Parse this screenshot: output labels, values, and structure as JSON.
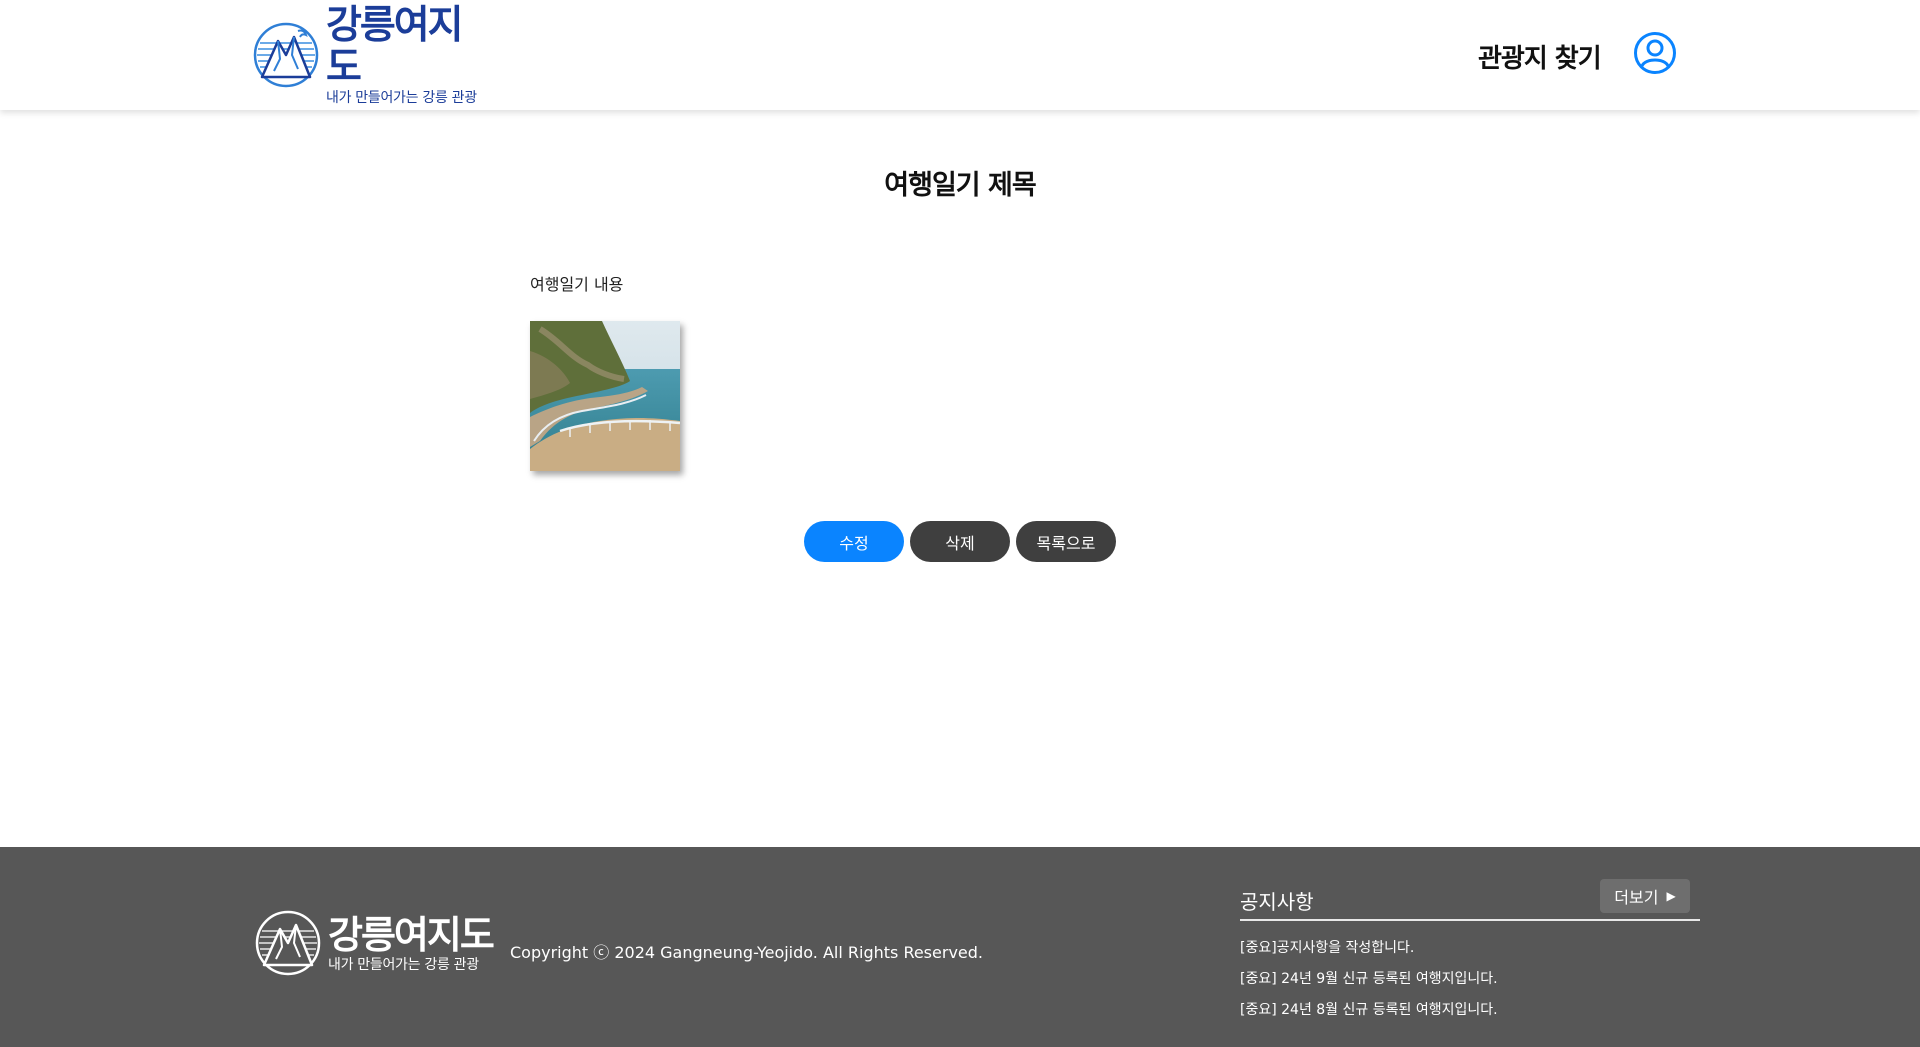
{
  "header": {
    "logo_title": "강릉여지도",
    "logo_subtitle": "내가 만들어가는 강릉 관광",
    "nav_find": "관광지 찾기",
    "user_icon": "user-circle-icon",
    "accent": "#1b3d99"
  },
  "diary": {
    "title": "여행일기 제목",
    "content": "여행일기 내용",
    "image": "coastal-walkway-photo"
  },
  "buttons": {
    "edit": "수정",
    "delete": "삭제",
    "list": "목록으로",
    "edit_color": "#0a84ff",
    "dark_color": "#3f3f3f"
  },
  "footer": {
    "logo_title": "강릉여지도",
    "logo_subtitle": "내가 만들어가는 강릉 관광",
    "copyright": "Copyright ⓒ 2024 Gangneung-Yeojido. All Rights Reserved.",
    "notice": {
      "title": "공지사항",
      "more": "더보기",
      "items": [
        "[중요]공지사항을 작성합니다.",
        "[중요] 24년 9월 신규 등록된 여행지입니다.",
        "[중요] 24년 8월 신규 등록된 여행지입니다."
      ]
    },
    "background": "#575757"
  }
}
